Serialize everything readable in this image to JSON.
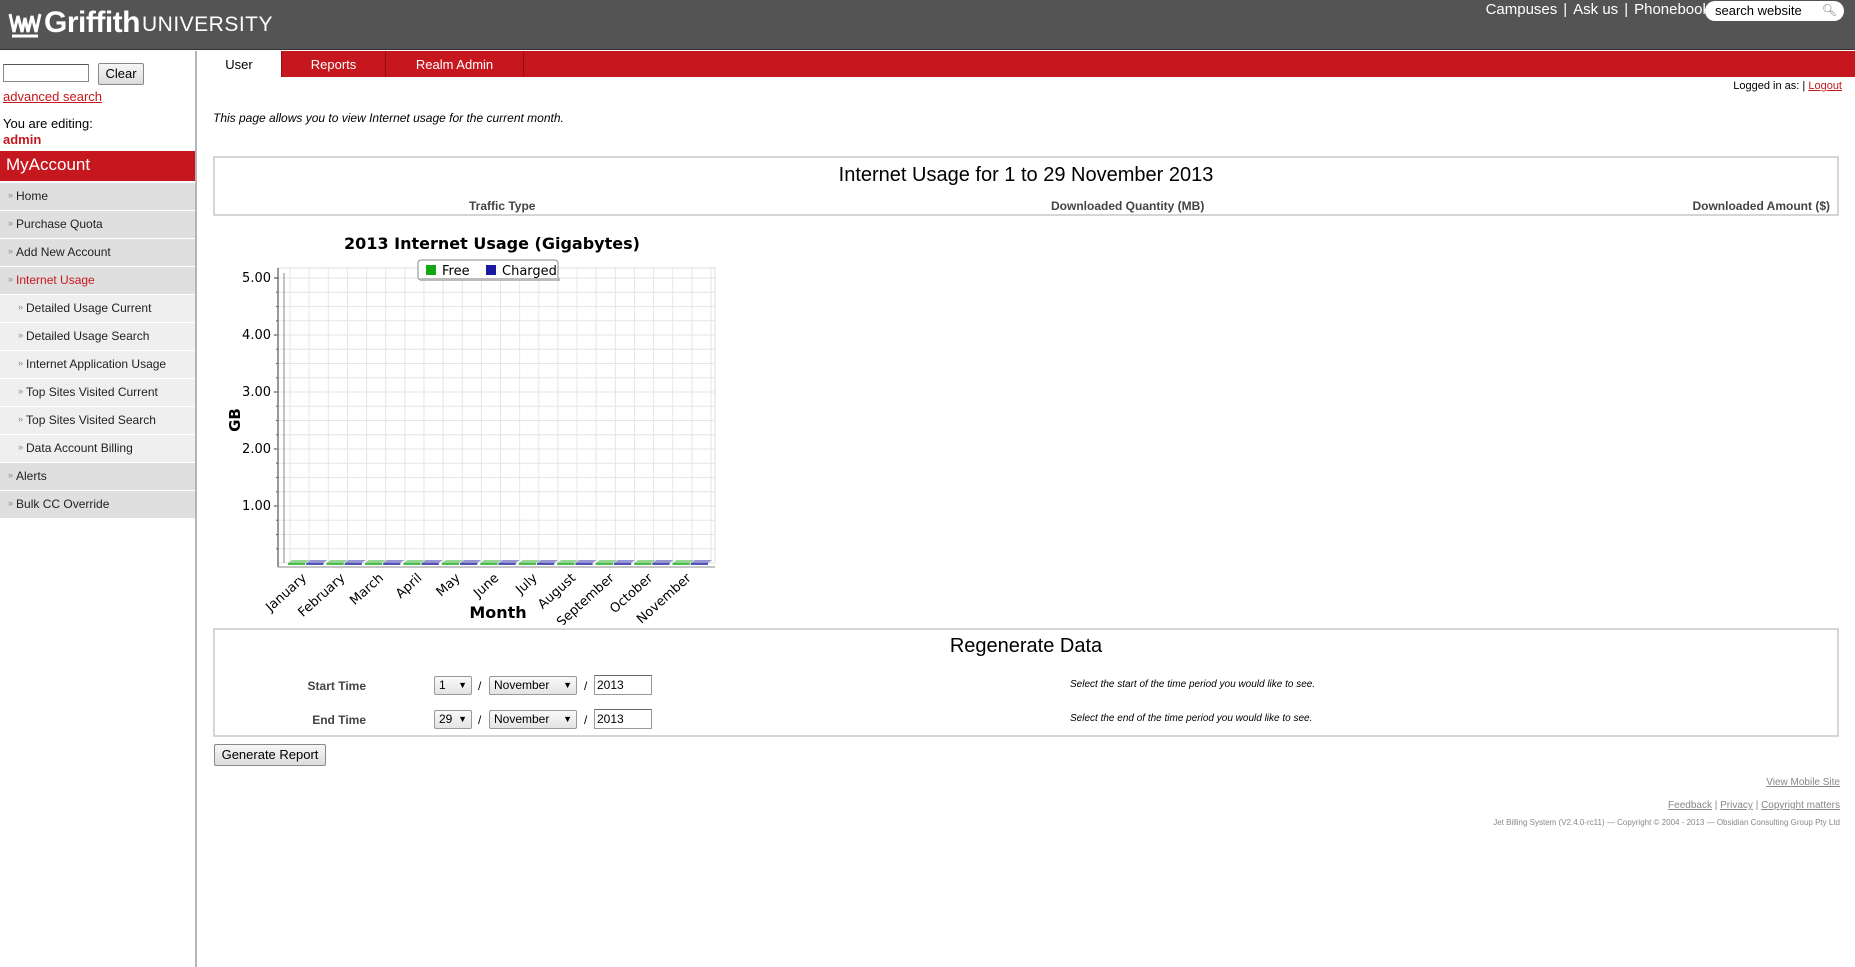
{
  "header": {
    "logo_main": "Griffith",
    "logo_sub": "UNIVERSITY",
    "links": [
      "Campuses",
      "Ask us",
      "Phonebook"
    ],
    "search_placeholder": "search website"
  },
  "sidebar": {
    "clear_label": "Clear",
    "advanced_search": "advanced search",
    "editing_label": "You are editing:",
    "editing_user": "admin",
    "section_title": "MyAccount",
    "items": [
      {
        "label": "Home",
        "sub": false,
        "active": false
      },
      {
        "label": "Purchase Quota",
        "sub": false,
        "active": false
      },
      {
        "label": "Add New Account",
        "sub": false,
        "active": false
      },
      {
        "label": "Internet Usage",
        "sub": false,
        "active": true
      },
      {
        "label": "Detailed Usage Current",
        "sub": true,
        "active": false
      },
      {
        "label": "Detailed Usage Search",
        "sub": true,
        "active": false
      },
      {
        "label": "Internet Application Usage",
        "sub": true,
        "active": false
      },
      {
        "label": "Top Sites Visited Current",
        "sub": true,
        "active": false
      },
      {
        "label": "Top Sites Visited Search",
        "sub": true,
        "active": false
      },
      {
        "label": "Data Account Billing",
        "sub": true,
        "active": false
      },
      {
        "label": "Alerts",
        "sub": false,
        "active": false
      },
      {
        "label": "Bulk CC Override",
        "sub": false,
        "active": false
      }
    ]
  },
  "tabs": [
    "User",
    "Reports",
    "Realm Admin"
  ],
  "active_tab": "User",
  "login": {
    "label": "Logged in as:",
    "separator": "|",
    "logout": "Logout"
  },
  "intro": "This page allows you to view Internet usage for the current month.",
  "usage": {
    "title": "Internet Usage for 1 to 29 November 2013",
    "columns": [
      "Traffic Type",
      "Downloaded Quantity (MB)",
      "Downloaded Amount ($)"
    ]
  },
  "chart_data": {
    "type": "bar",
    "title": "2013 Internet Usage (Gigabytes)",
    "xlabel": "Month",
    "ylabel": "GB",
    "ylim": [
      0,
      5
    ],
    "yticks": [
      "1.00",
      "2.00",
      "3.00",
      "4.00",
      "5.00"
    ],
    "categories": [
      "January",
      "February",
      "March",
      "April",
      "May",
      "June",
      "July",
      "August",
      "September",
      "October",
      "November"
    ],
    "series": [
      {
        "name": "Free",
        "values": [
          0,
          0,
          0,
          0,
          0,
          0,
          0,
          0,
          0,
          0,
          0
        ],
        "color": "#12a812"
      },
      {
        "name": "Charged",
        "values": [
          0,
          0,
          0,
          0,
          0,
          0,
          0,
          0,
          0,
          0,
          0
        ],
        "color": "#1a1aa0"
      }
    ],
    "grid": true,
    "legend": "top"
  },
  "regen": {
    "title": "Regenerate Data",
    "start": {
      "label": "Start Time",
      "day": "1",
      "month": "November",
      "year": "2013",
      "hint": "Select the start of the time period you would like to see."
    },
    "end": {
      "label": "End Time",
      "day": "29",
      "month": "November",
      "year": "2013",
      "hint": "Select the end of the time period you would like to see."
    },
    "slash": "/",
    "button": "Generate Report"
  },
  "footer": {
    "mobile": "View Mobile Site",
    "links": [
      "Feedback",
      "Privacy",
      "Copyright matters"
    ],
    "copyright": "Jet Billing System (V2.4.0-rc11) — Copyright © 2004 - 2013 — Obsidian Consulting Group Pty Ltd"
  }
}
